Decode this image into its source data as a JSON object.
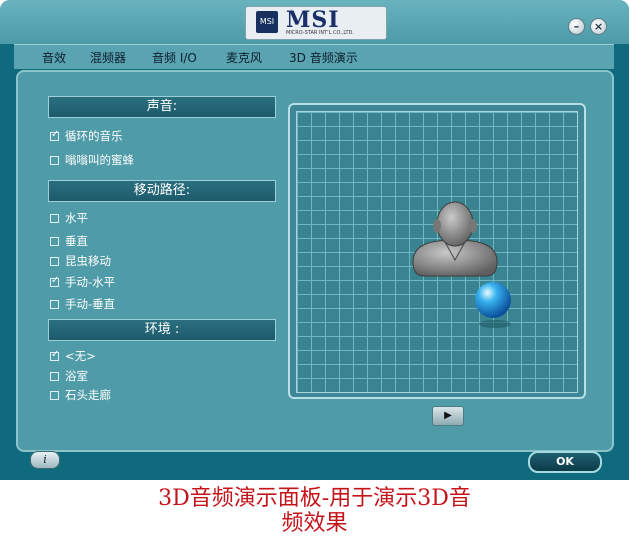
{
  "window": {
    "brand": "MSI",
    "brand_tagline": "MICRO-STAR INT'L CO.,LTD.",
    "emblem": "MSI",
    "minimize_glyph": "–",
    "close_glyph": "×"
  },
  "tabs": [
    "音效",
    "混频器",
    "音频 I/O",
    "麦克风",
    "3D 音频演示"
  ],
  "sections": {
    "sound": {
      "title": "声音:",
      "items": [
        {
          "label": "循环的音乐",
          "checked": true
        },
        {
          "label": "嗡嗡叫的蜜蜂",
          "checked": false
        }
      ]
    },
    "path": {
      "title": "移动路径:",
      "items": [
        {
          "label": "水平",
          "checked": false
        },
        {
          "label": "垂直",
          "checked": false
        },
        {
          "label": "昆虫移动",
          "checked": false
        },
        {
          "label": "手动-水平",
          "checked": true
        },
        {
          "label": "手动-垂直",
          "checked": false
        }
      ]
    },
    "environment": {
      "title": "环境 :",
      "items": [
        {
          "label": "<无>",
          "checked": true
        },
        {
          "label": "浴室",
          "checked": false
        },
        {
          "label": "石头走廊",
          "checked": false
        }
      ]
    }
  },
  "viewport": {
    "listener_icon": "head-listener-icon",
    "source_icon": "sound-source-sphere-icon"
  },
  "controls": {
    "play_glyph": "▶",
    "info_glyph": "i",
    "ok_label": "OK"
  },
  "caption": {
    "line1": "3D音频演示面板-用于演示3D音",
    "line2": "频效果"
  }
}
